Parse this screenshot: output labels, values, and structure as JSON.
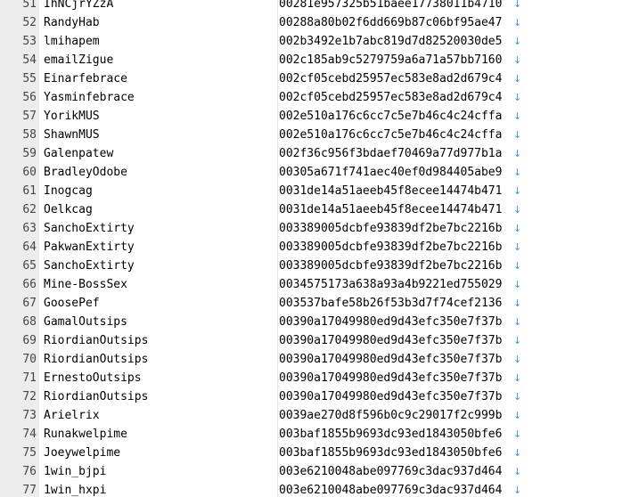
{
  "editor": {
    "eol_marker": "↓",
    "colors": {
      "gutter_bg": "#ececec",
      "line_number": "#444444",
      "text": "#000000",
      "eol_marker": "#3a8ee6"
    },
    "lines": [
      {
        "num": "51",
        "user": "IhNCjrYZzA",
        "hash": "00281e957325b51baee17738011b4710"
      },
      {
        "num": "52",
        "user": "RandyHab",
        "hash": "00288a80b02f6dd669b87c06bf95ae47"
      },
      {
        "num": "53",
        "user": "lmihapem",
        "hash": "002b3492e1b7abc819d7d82520030de5"
      },
      {
        "num": "54",
        "user": "emailZigue",
        "hash": "002c185ab9c5279759a6a71a57bb7160"
      },
      {
        "num": "55",
        "user": "Einarfebrace",
        "hash": "002cf05cebd25957ec583e8ad2d679c4"
      },
      {
        "num": "56",
        "user": "Yasminfebrace",
        "hash": "002cf05cebd25957ec583e8ad2d679c4"
      },
      {
        "num": "57",
        "user": "YorikMUS",
        "hash": "002e510a176c6cc7c5e7b46c4c24cffa"
      },
      {
        "num": "58",
        "user": "ShawnMUS",
        "hash": "002e510a176c6cc7c5e7b46c4c24cffa"
      },
      {
        "num": "59",
        "user": "Galenpatew",
        "hash": "002f36c956f3bdaef70469a77d977b1a"
      },
      {
        "num": "60",
        "user": "BradleyOdobe",
        "hash": "00305a671f741aec40ef0d984405abe9"
      },
      {
        "num": "61",
        "user": "Inogcag",
        "hash": "0031de14a51aeeb45f8ecee14474b471"
      },
      {
        "num": "62",
        "user": "Oelkcag",
        "hash": "0031de14a51aeeb45f8ecee14474b471"
      },
      {
        "num": "63",
        "user": "SanchoExtirty",
        "hash": "003389005dcbfe93839df2be7bc2216b"
      },
      {
        "num": "64",
        "user": "PakwanExtirty",
        "hash": "003389005dcbfe93839df2be7bc2216b"
      },
      {
        "num": "65",
        "user": "SanchoExtirty",
        "hash": "003389005dcbfe93839df2be7bc2216b"
      },
      {
        "num": "66",
        "user": "Mine-BossSex",
        "hash": "0034575173a638a93a4b9221ed755029"
      },
      {
        "num": "67",
        "user": "GoosePef",
        "hash": "003537bafe58b26f53b3d7f74cef2136"
      },
      {
        "num": "68",
        "user": "GamalOutsips",
        "hash": "00390a17049980ed9d43efc350e7f37b"
      },
      {
        "num": "69",
        "user": "RiordianOutsips",
        "hash": "00390a17049980ed9d43efc350e7f37b"
      },
      {
        "num": "70",
        "user": "RiordianOutsips",
        "hash": "00390a17049980ed9d43efc350e7f37b"
      },
      {
        "num": "71",
        "user": "ErnestoOutsips",
        "hash": "00390a17049980ed9d43efc350e7f37b"
      },
      {
        "num": "72",
        "user": "RiordianOutsips",
        "hash": "00390a17049980ed9d43efc350e7f37b"
      },
      {
        "num": "73",
        "user": "Arielrix",
        "hash": "0039ae270d8f596b0c9c29017f2c999b"
      },
      {
        "num": "74",
        "user": "Runakwelpime",
        "hash": "003baf1855b9693dc93ed1843050bfe6"
      },
      {
        "num": "75",
        "user": "Joeywelpime",
        "hash": "003baf1855b9693dc93ed1843050bfe6"
      },
      {
        "num": "76",
        "user": "1win_bjpi",
        "hash": "003e6210048abe097769c3dac937d464"
      },
      {
        "num": "77",
        "user": "1win_hxpi",
        "hash": "003e6210048abe097769c3dac937d464"
      }
    ]
  }
}
